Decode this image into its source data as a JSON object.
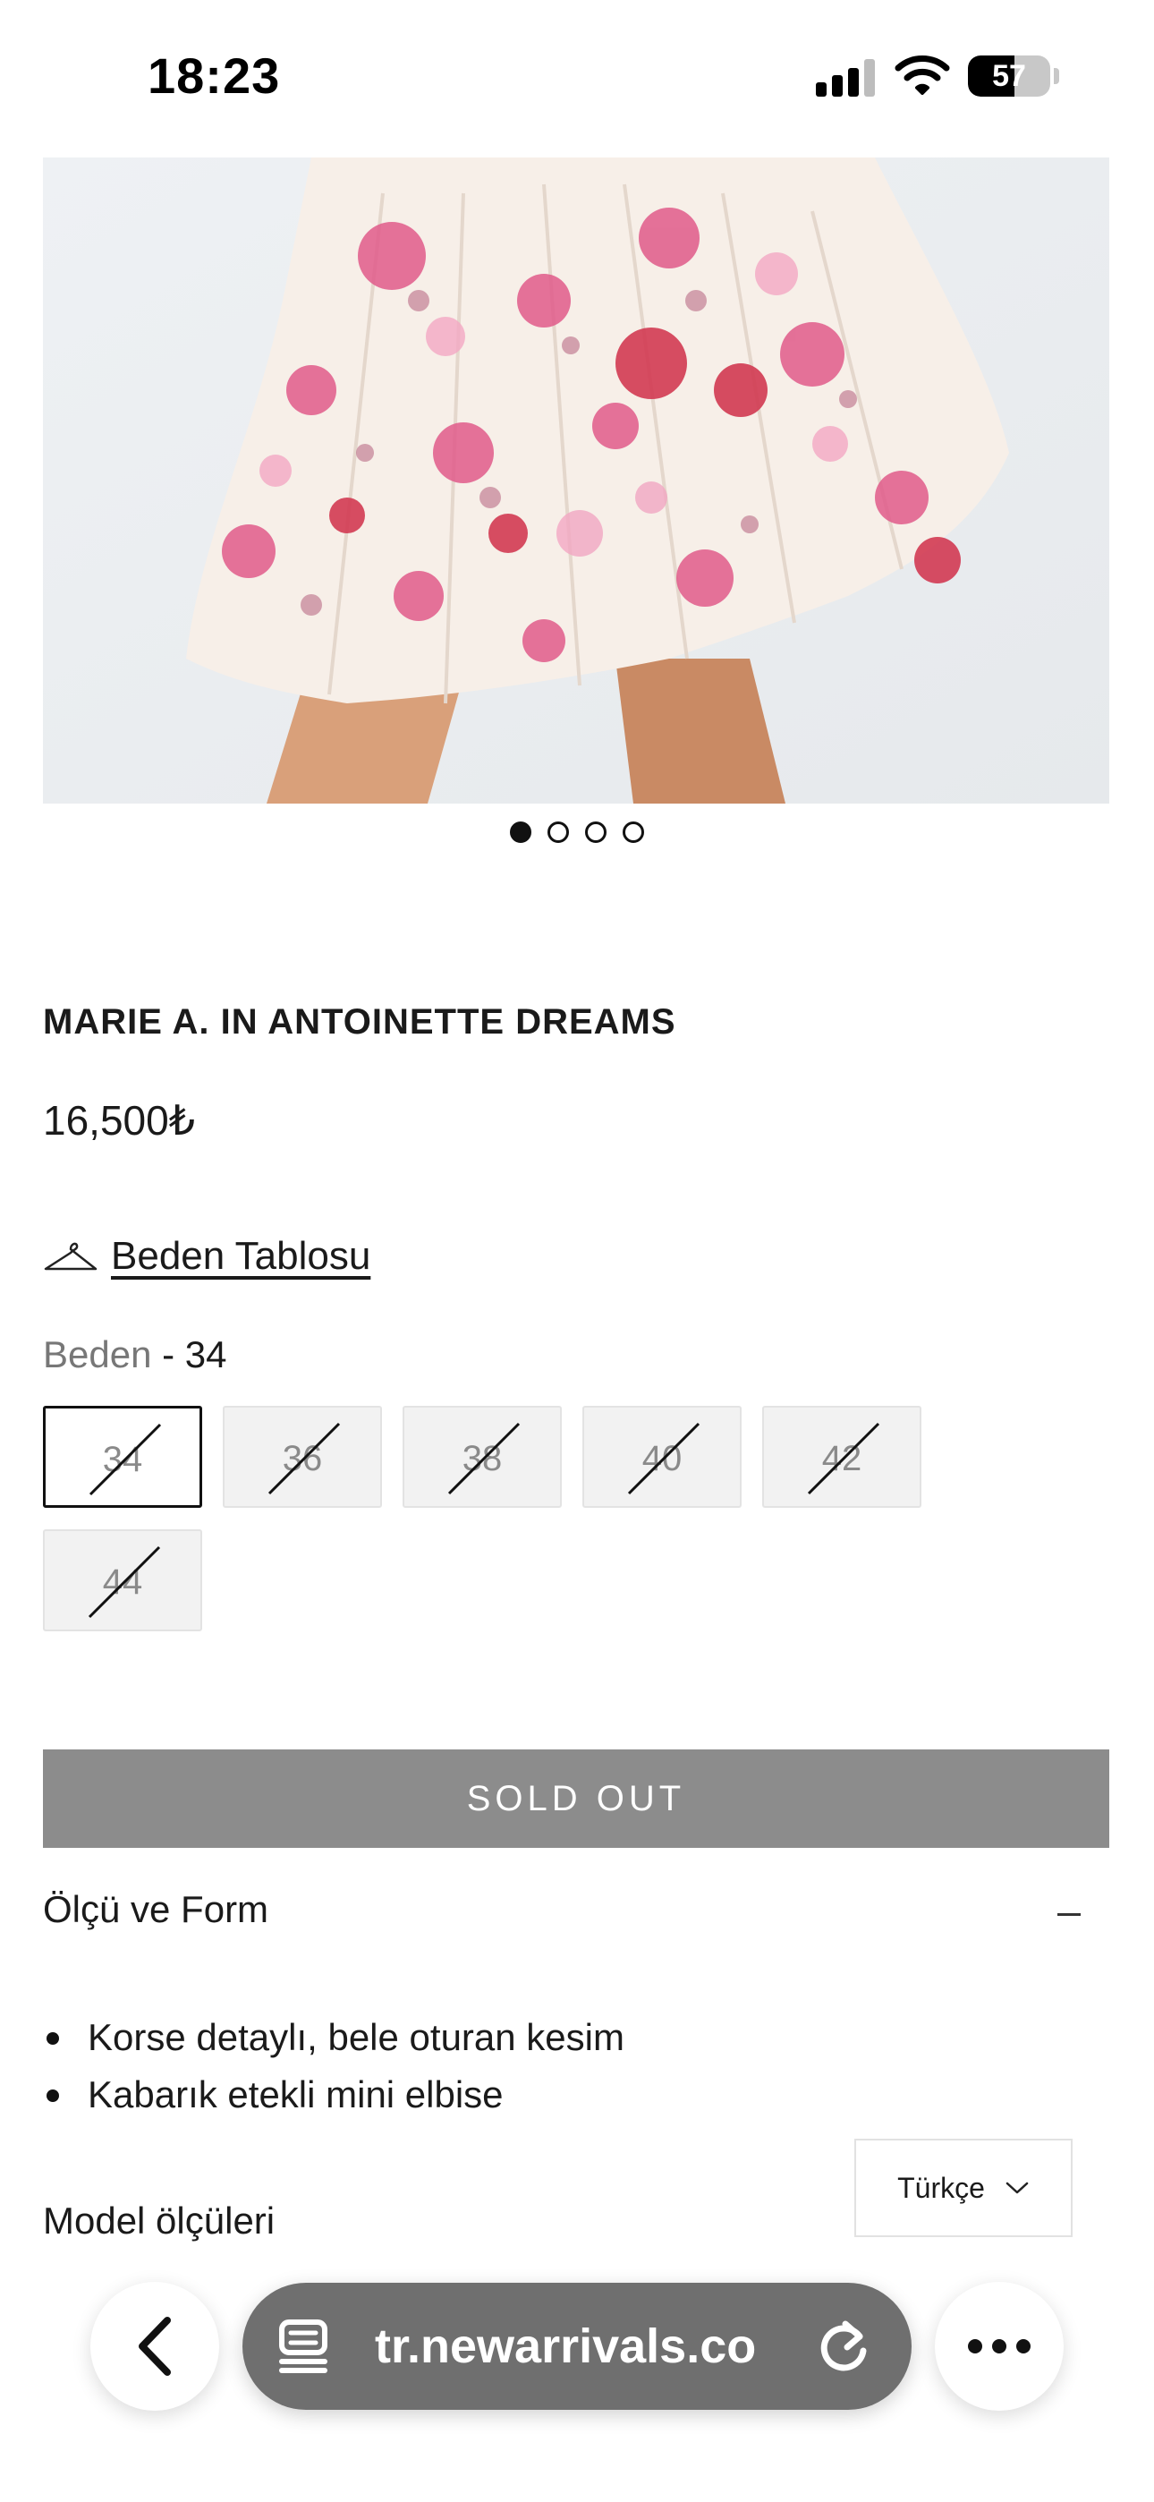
{
  "status_bar": {
    "time": "18:23",
    "battery_level": "57",
    "battery_fraction": 0.57
  },
  "carousel": {
    "total": 4,
    "active_index": 0
  },
  "product": {
    "title": "MARIE A. IN ANTOINETTE DREAMS",
    "price": "16,500₺",
    "size_chart_label": "Beden Tablosu",
    "size_label": "Beden",
    "selected_size_text": " - 34",
    "sizes": [
      {
        "value": "34",
        "available": false,
        "selected": true
      },
      {
        "value": "36",
        "available": false,
        "selected": false
      },
      {
        "value": "38",
        "available": false,
        "selected": false
      },
      {
        "value": "40",
        "available": false,
        "selected": false
      },
      {
        "value": "42",
        "available": false,
        "selected": false
      },
      {
        "value": "44",
        "available": false,
        "selected": false
      }
    ],
    "sold_out_label": "SOLD OUT",
    "accordion_title": "Ölçü ve Form",
    "features": [
      "Korse detaylı, bele oturan kesim",
      "Kabarık etekli mini elbise"
    ],
    "model_measurements_label": "Model ölçüleri"
  },
  "language": {
    "selected": "Türkçe"
  },
  "browser": {
    "url": "tr.newarrivals.co"
  },
  "colors": {
    "sold_out_bg": "#8c8c8c",
    "address_bar_bg": "#6f6f6f",
    "print_pink": "#e05a8a",
    "print_red": "#d23a52"
  },
  "icons": [
    "hanger-icon",
    "chevron-down-icon",
    "back-chevron-icon",
    "reader-icon",
    "reload-icon",
    "more-icon",
    "signal-icon",
    "wifi-icon",
    "battery-icon"
  ]
}
